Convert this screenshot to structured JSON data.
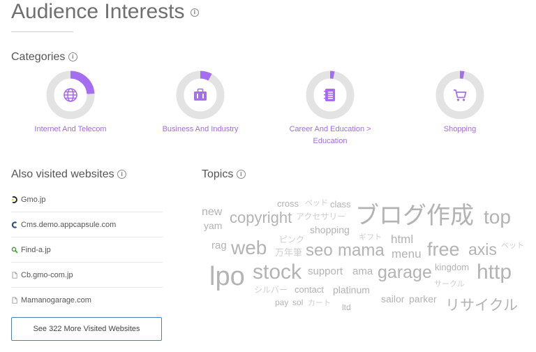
{
  "page": {
    "title": "Audience Interests"
  },
  "categories": {
    "title": "Categories",
    "items": [
      {
        "label_lines": [
          "Internet And Telecom"
        ],
        "share": 0.24,
        "icon": "globe-icon"
      },
      {
        "label_lines": [
          "Business And Industry"
        ],
        "share": 0.08,
        "icon": "briefcase-icon"
      },
      {
        "label_lines": [
          "Career And Education >",
          "Education"
        ],
        "share": 0.03,
        "icon": "notebook-icon"
      },
      {
        "label_lines": [
          "Shopping"
        ],
        "share": 0.03,
        "icon": "cart-icon"
      }
    ],
    "accent_color": "#a56df0",
    "track_color": "#e3e3e3"
  },
  "also_visited": {
    "title": "Also visited websites",
    "sites": [
      {
        "name": "Gmo.jp",
        "icon": "gmo-favicon-icon"
      },
      {
        "name": "Cms.demo.appcapsule.com",
        "icon": "appcapsule-favicon-icon"
      },
      {
        "name": "Find-a.jp",
        "icon": "find-a-favicon-icon"
      },
      {
        "name": "Cb.gmo-com.jp",
        "icon": "document-icon"
      },
      {
        "name": "Mamanogarage.com",
        "icon": "document-icon"
      }
    ],
    "see_more_label": "See 322 More Visited Websites"
  },
  "topics": {
    "title": "Topics",
    "words": [
      {
        "text": "cross",
        "tone": "mid"
      },
      {
        "text": "ベッド",
        "tone": "light"
      },
      {
        "text": "class",
        "tone": "mid"
      },
      {
        "text": "new",
        "tone": "mid"
      },
      {
        "text": "yam",
        "tone": "mid"
      },
      {
        "text": "copyright",
        "tone": "mid"
      },
      {
        "text": "アクセサリー",
        "tone": "light"
      },
      {
        "text": "ブログ作成",
        "tone": "mid"
      },
      {
        "text": "top",
        "tone": "mid"
      },
      {
        "text": "shopping",
        "tone": "mid"
      },
      {
        "text": "ピンク",
        "tone": "light"
      },
      {
        "text": "ギフト",
        "tone": "light"
      },
      {
        "text": "html",
        "tone": "mid"
      },
      {
        "text": "rag",
        "tone": "mid"
      },
      {
        "text": "web",
        "tone": "mid"
      },
      {
        "text": "万年筆",
        "tone": "light"
      },
      {
        "text": "seo",
        "tone": "mid"
      },
      {
        "text": "mama",
        "tone": "mid"
      },
      {
        "text": "menu",
        "tone": "mid"
      },
      {
        "text": "free",
        "tone": "mid"
      },
      {
        "text": "axis",
        "tone": "mid"
      },
      {
        "text": "ベット",
        "tone": "light"
      },
      {
        "text": "lpo",
        "tone": "mid"
      },
      {
        "text": "stock",
        "tone": "mid"
      },
      {
        "text": "support",
        "tone": "mid"
      },
      {
        "text": "ama",
        "tone": "mid"
      },
      {
        "text": "garage",
        "tone": "mid"
      },
      {
        "text": "kingdom",
        "tone": "mid"
      },
      {
        "text": "http",
        "tone": "mid"
      },
      {
        "text": "シルバー",
        "tone": "light"
      },
      {
        "text": "contact",
        "tone": "mid"
      },
      {
        "text": "platinum",
        "tone": "mid"
      },
      {
        "text": "サークル",
        "tone": "light"
      },
      {
        "text": "pay",
        "tone": "mid"
      },
      {
        "text": "sol",
        "tone": "mid"
      },
      {
        "text": "カート",
        "tone": "light"
      },
      {
        "text": "ltd",
        "tone": "mid"
      },
      {
        "text": "sailor",
        "tone": "mid"
      },
      {
        "text": "parker",
        "tone": "mid"
      },
      {
        "text": "リサイクル",
        "tone": "mid"
      }
    ]
  }
}
